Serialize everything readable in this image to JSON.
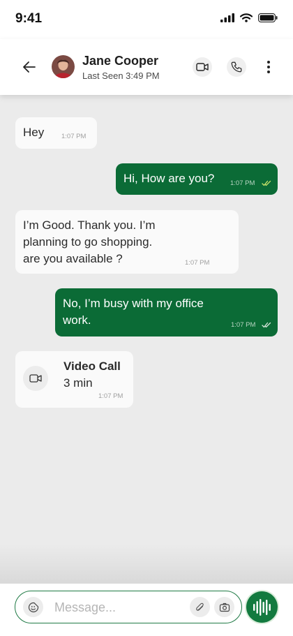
{
  "status_bar": {
    "time": "9:41"
  },
  "header": {
    "contact_name": "Jane Cooper",
    "last_seen": "Last Seen 3:49 PM"
  },
  "messages": [
    {
      "direction": "incoming",
      "text": "Hey",
      "time": "1:07 PM"
    },
    {
      "direction": "outgoing",
      "text": "Hi, How are you?",
      "time": "1:07 PM",
      "read": true
    },
    {
      "direction": "incoming",
      "lines": [
        "I’m Good. Thank you. I’m",
        "planning to go shopping.",
        "are you available ?"
      ],
      "time": "1:07 PM"
    },
    {
      "direction": "outgoing",
      "lines": [
        "No, I’m busy with my office",
        "work."
      ],
      "time": "1:07 PM",
      "read": false
    },
    {
      "direction": "incoming",
      "type": "call",
      "title": "Video Call",
      "duration": "3 min",
      "time": "1:07 PM"
    }
  ],
  "composer": {
    "placeholder": "Message..."
  },
  "colors": {
    "brand_green": "#0b6b36",
    "background": "#ebebeb",
    "incoming_bubble": "#fafafa",
    "read_tick": "#c9e36a"
  },
  "icons": [
    "back-arrow-icon",
    "video-camera-icon",
    "phone-icon",
    "more-vertical-icon",
    "emoji-icon",
    "paperclip-icon",
    "camera-icon",
    "voice-wave-icon"
  ]
}
